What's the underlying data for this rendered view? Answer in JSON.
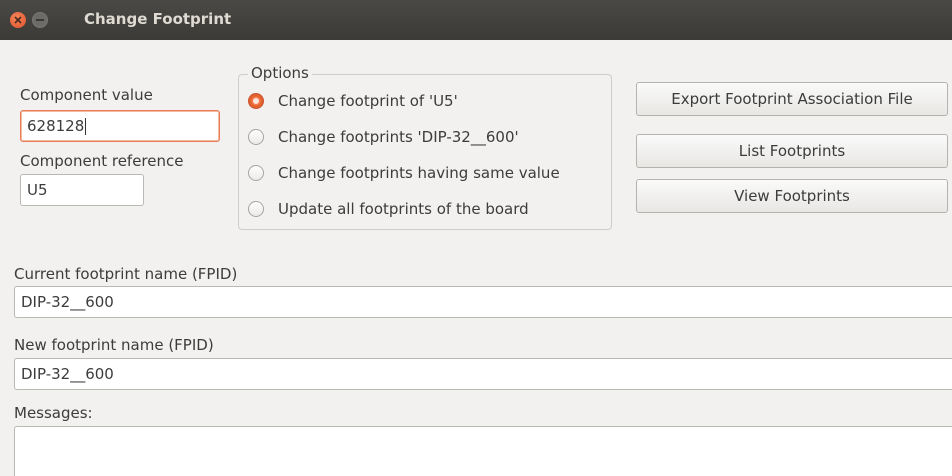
{
  "window": {
    "title": "Change Footprint"
  },
  "component": {
    "value_label": "Component value",
    "value": "628128",
    "reference_label": "Component reference",
    "reference": "U5"
  },
  "options": {
    "legend": "Options",
    "items": [
      {
        "label": "Change footprint of 'U5'",
        "checked": true
      },
      {
        "label": "Change footprints 'DIP-32__600'",
        "checked": false
      },
      {
        "label": "Change footprints having same value",
        "checked": false
      },
      {
        "label": "Update all footprints of the board",
        "checked": false
      }
    ]
  },
  "buttons": {
    "export": "Export Footprint Association File",
    "list": "List Footprints",
    "view": "View Footprints"
  },
  "footprint": {
    "current_label": "Current footprint name (FPID)",
    "current_value": "DIP-32__600",
    "new_label": "New footprint name (FPID)",
    "new_value": "DIP-32__600"
  },
  "messages": {
    "label": "Messages:",
    "content": ""
  },
  "colors": {
    "accent": "#e46232",
    "titlebar": "#3c3b37",
    "window_bg": "#f2f1f0"
  }
}
